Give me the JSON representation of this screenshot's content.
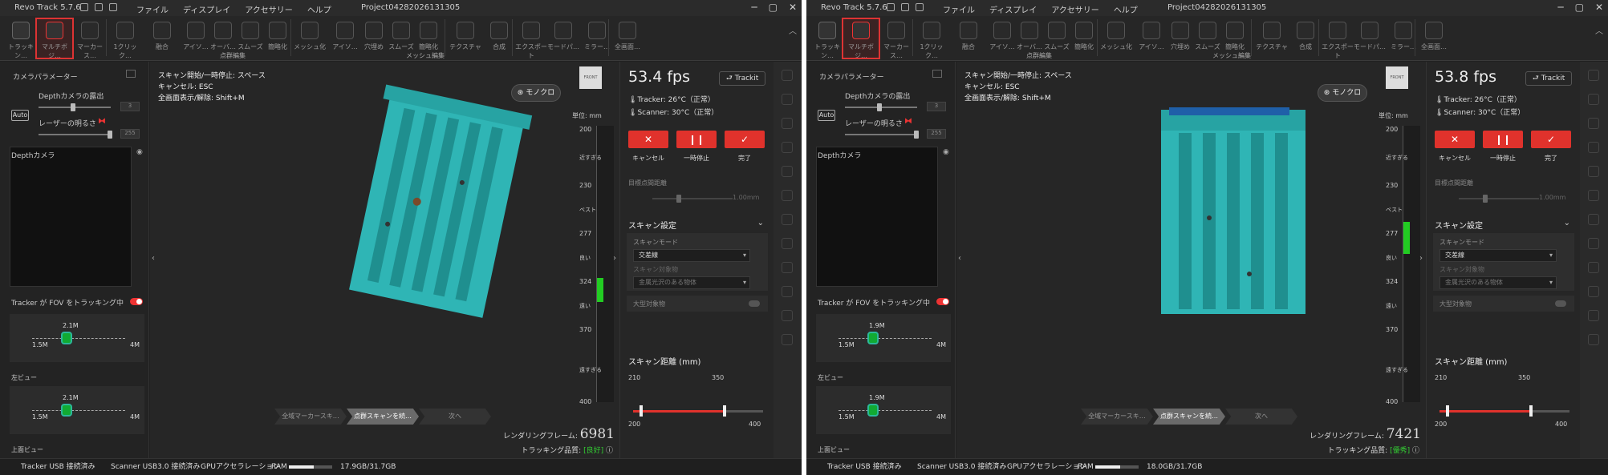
{
  "app": {
    "title": "Revo Track 5.7.6",
    "project": "Project04282026131305"
  },
  "menu": [
    "ファイル",
    "ディスプレイ",
    "アクセサリー",
    "ヘルプ"
  ],
  "toolbar": {
    "tools": [
      "トラッキン…",
      "マルチボジ…",
      "マーカース…",
      "1クリック…",
      "融合",
      "アイソ…",
      "オーバ…",
      "スムーズ",
      "簡略化",
      "メッシュ化",
      "アイソ…",
      "穴埋め",
      "スムーズ",
      "簡略化",
      "テクスチャ",
      "合成",
      "エクスポート",
      "モードパ…",
      "ミラー…",
      "全画面…"
    ],
    "groups": [
      "点群編集",
      "メッシュ編集"
    ]
  },
  "left_panel": {
    "title": "カメラパラメーター",
    "depth_exposure": "Depthカメラの露出",
    "auto": "Auto",
    "laser": "レーザーの明るさ",
    "exposure_val": "3",
    "laser_val": "255",
    "depth_view": "Depthカメラ",
    "tracking_status": "Tracker が FOV をトラッキング中",
    "left_view": "左ビュー",
    "top_view": "上面ビュー",
    "near": "1.5M",
    "far": "4M"
  },
  "viewport": {
    "hints": [
      "スキャン開始/一時停止: スペース",
      "キャンセル: ESC",
      "全画面表示/解除: Shift+M"
    ],
    "mono": "モノクロ",
    "unit": "単位: mm",
    "ruler_ticks": [
      "200",
      "230",
      "277",
      "324",
      "370",
      "400"
    ],
    "ruler_words": [
      "近すぎる",
      "ベスト",
      "良い",
      "遠い",
      "遠すぎる"
    ],
    "steps": [
      "全域マーカースキ…",
      "点群スキャンを続…",
      "次へ"
    ],
    "frames_label": "レンダリングフレーム:",
    "quality_label": "トラッキング品質:",
    "axis_label": "FRONT"
  },
  "right_panel": {
    "trackit": "Trackit",
    "tracker_temp": "Tracker: 26°C（正常）",
    "scanner_temp": "Scanner: 30°C（正常）",
    "cancel": "キャンセル",
    "pause": "一時停止",
    "done": "完了",
    "point_dist": "目標点間距離",
    "point_dist_val": "1.00mm",
    "scan_settings": "スキャン設定",
    "scan_mode_label": "スキャンモード",
    "scan_mode": "交差線",
    "scan_target_label": "スキャン対象物",
    "scan_target": "金属光沢のある物体",
    "large_object": "大型対象物",
    "scan_distance": "スキャン距離 (mm)",
    "dist_min": "210",
    "dist_max": "350",
    "range_lo": "200",
    "range_hi": "400"
  },
  "status": {
    "tracker": "Tracker USB 接続済み",
    "scanner": "Scanner USB3.0 接続済み",
    "gpu": "GPUアクセラレーション",
    "ram_label": "RAM"
  },
  "screens": [
    {
      "fps": "53.4 fps",
      "frames": "6981",
      "quality": "[良好]",
      "ram": "17.9GB/31.7GB",
      "ram_fraction": 0.565,
      "fov_dist": "2.1M"
    },
    {
      "fps": "53.8 fps",
      "frames": "7421",
      "quality": "[優秀]",
      "ram": "18.0GB/31.7GB",
      "ram_fraction": 0.568,
      "fov_dist": "1.9M"
    }
  ],
  "colors": {
    "accent": "#e0322c",
    "cloud": "#2fb5b5",
    "good": "#33cc33"
  }
}
